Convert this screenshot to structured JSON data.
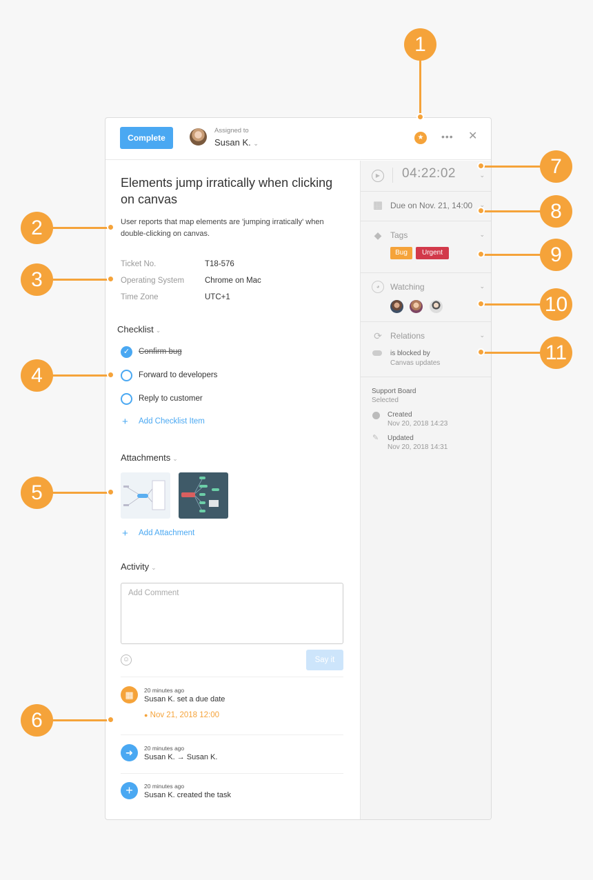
{
  "header": {
    "complete_label": "Complete",
    "assigned_label": "Assigned to",
    "assignee": "Susan K.",
    "assignee_chevron": "⌄",
    "star_icon": "star-icon",
    "more_label": "•••",
    "close_label": "✕"
  },
  "task": {
    "title": "Elements jump irratically when clicking on canvas",
    "description": "User reports that map elements are 'jumping irratically' when double-clicking on canvas.",
    "fields": [
      {
        "key": "Ticket No.",
        "value": "T18-576"
      },
      {
        "key": "Operating System",
        "value": "Chrome on Mac"
      },
      {
        "key": "Time Zone",
        "value": "UTC+1"
      }
    ]
  },
  "checklist": {
    "title": "Checklist",
    "items": [
      {
        "label": "Confirm bug",
        "done": true
      },
      {
        "label": "Forward to developers",
        "done": false
      },
      {
        "label": "Reply to customer",
        "done": false
      }
    ],
    "add_label": "Add Checklist Item"
  },
  "attachments": {
    "title": "Attachments",
    "add_label": "Add Attachment"
  },
  "activity": {
    "title": "Activity",
    "comment_placeholder": "Add Comment",
    "submit_label": "Say it",
    "items": [
      {
        "time": "20 minutes ago",
        "text": "Susan K. set a due date",
        "date": "Nov 21, 2018 12:00",
        "icon": "calendar-icon",
        "color": "#f5a33a"
      },
      {
        "time": "20 minutes ago",
        "text": "Susan K. → Susan K.",
        "icon": "arrow-right-icon",
        "color": "#4aa8f2"
      },
      {
        "time": "20 minutes ago",
        "text": "Susan K. created the task",
        "icon": "plus-icon",
        "color": "#4aa8f2"
      }
    ]
  },
  "sidebar": {
    "timer": "04:22:02",
    "due": "Due on Nov. 21, 14:00",
    "tags_label": "Tags",
    "tags": [
      {
        "label": "Bug",
        "color": "#f5a33a"
      },
      {
        "label": "Urgent",
        "color": "#d2394a"
      }
    ],
    "watching_label": "Watching",
    "relations_label": "Relations",
    "relation_type": "is blocked by",
    "relation_target": "Canvas updates",
    "board_name": "Support Board",
    "board_status": "Selected",
    "created_label": "Created",
    "created_date": "Nov 20, 2018 14:23",
    "updated_label": "Updated",
    "updated_date": "Nov 20, 2018 14:31"
  },
  "callouts": [
    "1",
    "2",
    "3",
    "4",
    "5",
    "6",
    "7",
    "8",
    "9",
    "10",
    "11"
  ],
  "colors": {
    "accent": "#4aa8f2",
    "callout": "#f5a33a"
  }
}
